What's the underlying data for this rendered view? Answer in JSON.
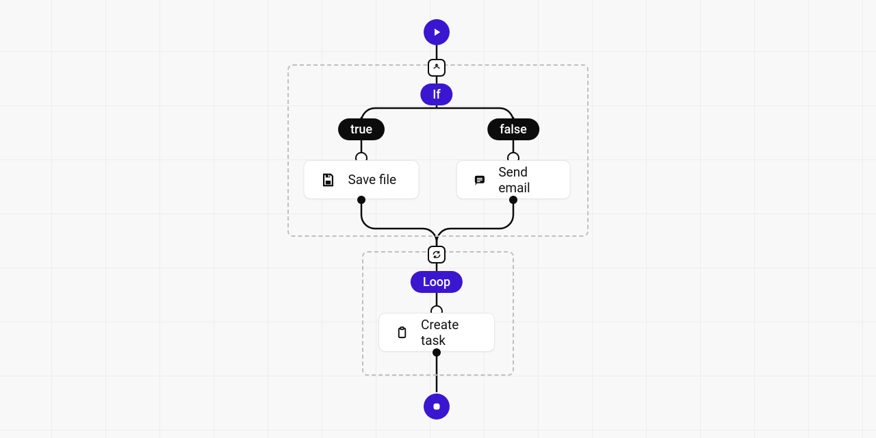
{
  "if_label": "If",
  "true_label": "true",
  "false_label": "false",
  "save_file": "Save file",
  "send_email": "Send email",
  "loop_label": "Loop",
  "create_task": "Create task",
  "icons": {
    "start": "play-icon",
    "branch": "branch-icon",
    "loop": "cycle-icon",
    "save": "save-icon",
    "email": "message-icon",
    "task": "clipboard-icon",
    "end": "stop-icon"
  }
}
